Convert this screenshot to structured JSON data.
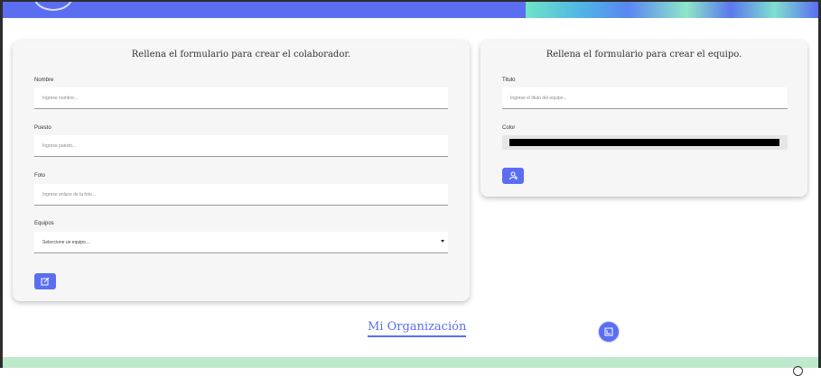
{
  "colaborador_form": {
    "title": "Rellena el formulario para crear el colaborador.",
    "nombre_label": "Nombre",
    "nombre_placeholder": "Ingrese nombre...",
    "puesto_label": "Puesto",
    "puesto_placeholder": "Ingrese puesto...",
    "foto_label": "Foto",
    "foto_placeholder": "Ingrese enlace de la foto...",
    "equipos_label": "Equipos",
    "equipos_selected": "Seleccione un equipo..."
  },
  "equipo_form": {
    "title": "Rellena el formulario para crear el equipo.",
    "titulo_label": "Titulo",
    "titulo_placeholder": "Ingrese el titulo del equipo...",
    "color_label": "Color",
    "color_value": "#000000"
  },
  "organization": {
    "title": "Mi Organización"
  },
  "colors": {
    "accent": "#5b6ef1",
    "card_bg": "#f6f6f6",
    "footer": "#bfe9cc"
  },
  "icons": {
    "create_collaborator": "edit-square-icon",
    "create_team": "add-user-icon",
    "toggle_form": "toggle-form-icon"
  }
}
